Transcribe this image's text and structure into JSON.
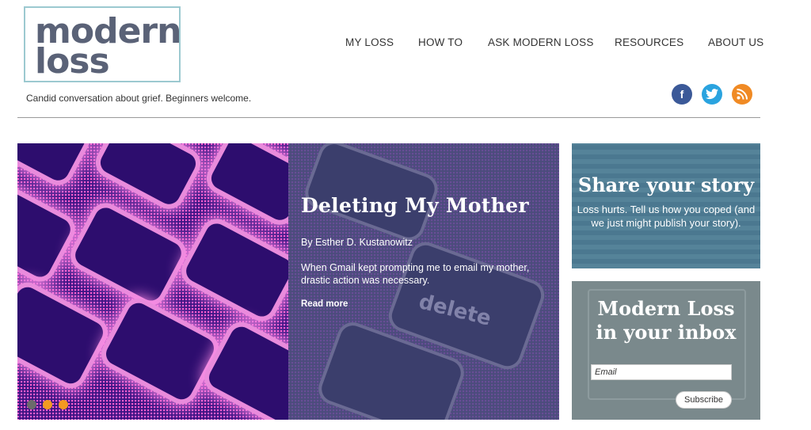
{
  "logo": {
    "line1": "modern",
    "line2": "loss"
  },
  "tagline": "Candid conversation about grief. Beginners welcome.",
  "nav": {
    "items": [
      "MY LOSS",
      "HOW TO",
      "ASK MODERN LOSS",
      "RESOURCES",
      "ABOUT US"
    ]
  },
  "social": {
    "facebook": {
      "glyph": "f",
      "icon": "facebook-icon",
      "color": "#3b5998"
    },
    "twitter": {
      "glyph": "🐦",
      "icon": "twitter-icon",
      "color": "#2aa3df"
    },
    "rss": {
      "glyph": "◉",
      "icon": "rss-icon",
      "color": "#f08a24"
    }
  },
  "hero": {
    "title": "Deleting My Mother",
    "byline": "By Esther D. Kustanowitz",
    "description": "When Gmail kept prompting me to email my mother, drastic action was necessary.",
    "read_more": "Read more",
    "key_text": "delete",
    "slider_dots": [
      {
        "color": "#6b6b6b",
        "active": true
      },
      {
        "color": "#f39a21",
        "active": false
      },
      {
        "color": "#f39a21",
        "active": false
      }
    ]
  },
  "share": {
    "title": "Share your story",
    "body": "Loss hurts. Tell us how you coped (and we just might publish your story)."
  },
  "inbox": {
    "title_line1": "Modern Loss",
    "title_line2": "in your inbox",
    "email_placeholder": "Email",
    "subscribe_label": "Subscribe"
  }
}
